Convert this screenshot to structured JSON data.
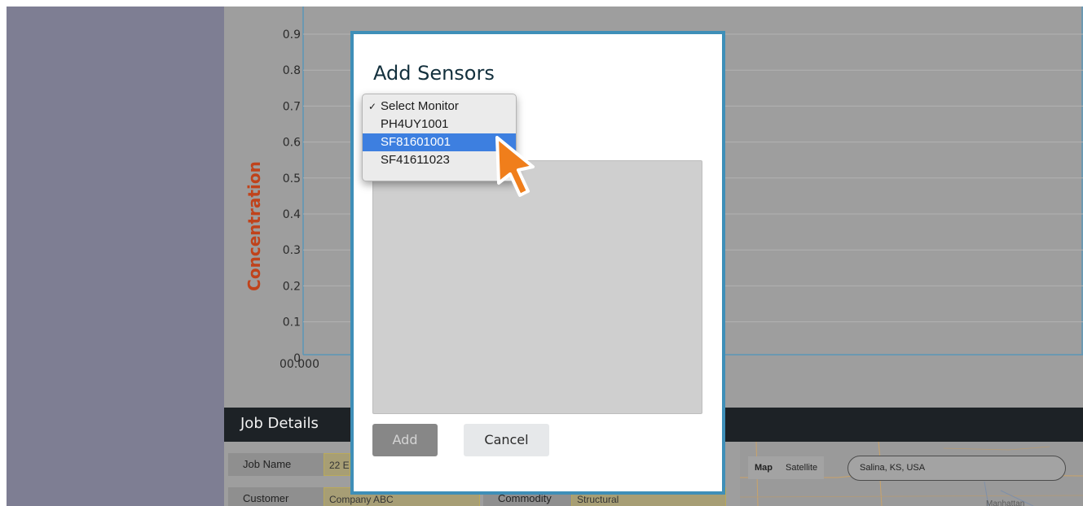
{
  "chart": {
    "ylabel": "Concentration",
    "y_ticks": [
      "0.9",
      "0.8",
      "0.7",
      "0.6",
      "0.5",
      "0.4",
      "0.3",
      "0.2",
      "0.1",
      "0"
    ],
    "x_start_label": "00.000"
  },
  "modal": {
    "title": "Add Sensors",
    "add_label": "Add",
    "cancel_label": "Cancel"
  },
  "monitor_select": {
    "check_mark": "✓",
    "options": [
      {
        "label": "Select Monitor",
        "checked": true,
        "highlighted": false
      },
      {
        "label": "PH4UY1001",
        "checked": false,
        "highlighted": false
      },
      {
        "label": "SF81601001",
        "checked": false,
        "highlighted": true
      },
      {
        "label": "SF41611023",
        "checked": false,
        "highlighted": false
      }
    ]
  },
  "job_details": {
    "title": "Job Details",
    "job_name_label": "Job Name",
    "job_name_value": "22 E",
    "customer_label": "Customer",
    "customer_value": "Company ABC",
    "commodity_label": "Commodity",
    "commodity_value": "Structural"
  },
  "map": {
    "map_label": "Map",
    "satellite_label": "Satellite",
    "search_value": "Salina, KS, USA",
    "city_label": "Manhattan"
  },
  "colors": {
    "modal_border": "#3f8fb8",
    "axis_title": "#c0431b",
    "highlight": "#3d7fe0",
    "cursor": "#f07e1b"
  }
}
